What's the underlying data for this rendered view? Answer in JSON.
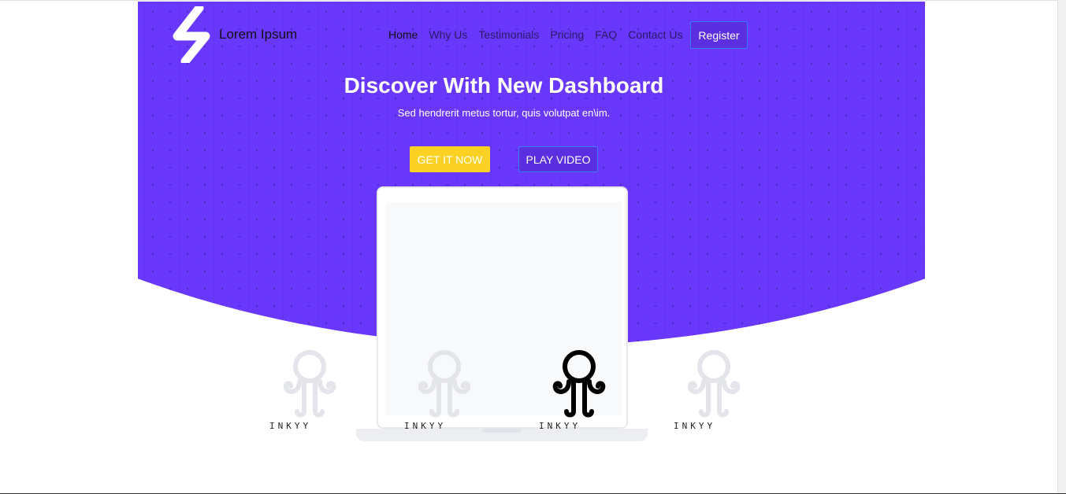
{
  "header": {
    "brand": "Lorem Ipsum",
    "logo_icon": "lightning-bolt-icon",
    "nav": [
      "Home",
      "Why Us",
      "Testimonials",
      "Pricing",
      "FAQ",
      "Contact Us"
    ],
    "register_label": "Register"
  },
  "hero": {
    "title": "Discover With New Dashboard",
    "subtitle": "Sed hendrerit metus tortur, quis volutpat en\\im.",
    "get_label": "GET IT NOW",
    "play_label": "PLAY VIDEO"
  },
  "clients": {
    "icon": "octopus-icon",
    "labels": [
      "INKYY",
      "INKYY",
      "INKYY",
      "INKYY"
    ]
  },
  "colors": {
    "hero": "#6a38fd",
    "accent_yellow": "#fbd224",
    "button_purple": "#5b2fe0"
  }
}
